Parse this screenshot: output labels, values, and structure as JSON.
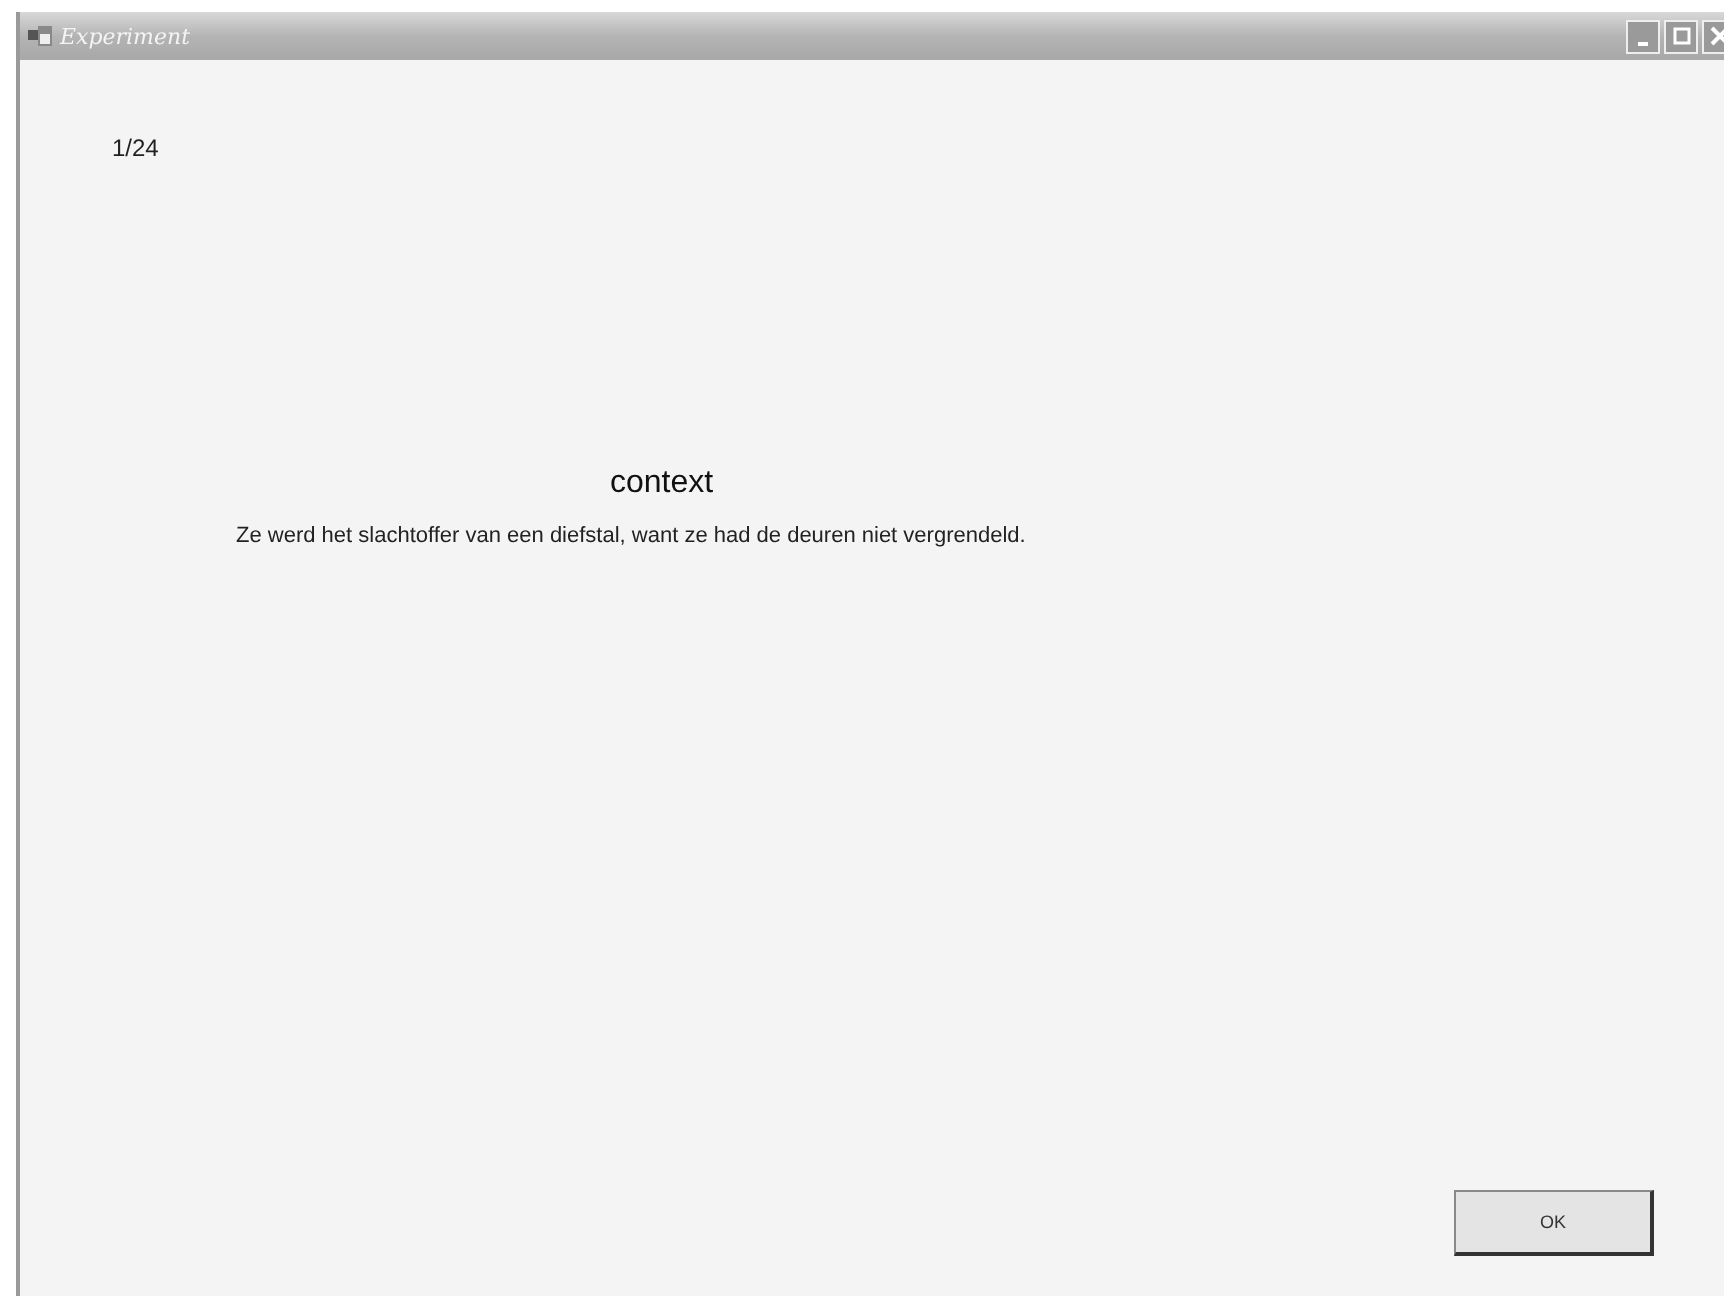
{
  "window": {
    "title": "Experiment"
  },
  "counter": "1/24",
  "heading": "context",
  "sentence": "Ze werd het slachtoffer van een diefstal, want ze had de deuren niet vergrendeld.",
  "buttons": [
    "OK"
  ]
}
